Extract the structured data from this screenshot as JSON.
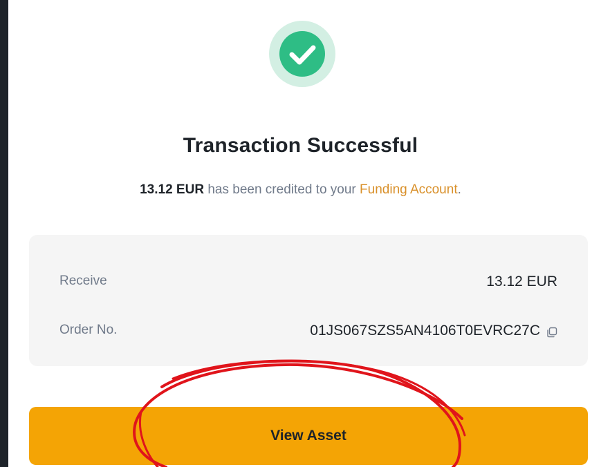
{
  "result": {
    "status_icon": "check-circle-icon",
    "title": "Transaction Successful",
    "message": {
      "amount": "13.12 EUR",
      "middle": " has been credited to your ",
      "account_link": "Funding Account",
      "end": "."
    }
  },
  "details": {
    "receive_label": "Receive",
    "receive_value": "13.12 EUR",
    "order_label": "Order No.",
    "order_value": "01JS067SZS5AN4106T0EVRC27C",
    "copy_icon": "copy-icon"
  },
  "action": {
    "view_asset_label": "View Asset"
  },
  "colors": {
    "backdrop": "#1e2329",
    "success_green": "#2ebd85",
    "success_ring": "#d3efe3",
    "accent_link": "#d9902a",
    "primary_button": "#f4a405",
    "annotation_red": "#e0141b"
  }
}
